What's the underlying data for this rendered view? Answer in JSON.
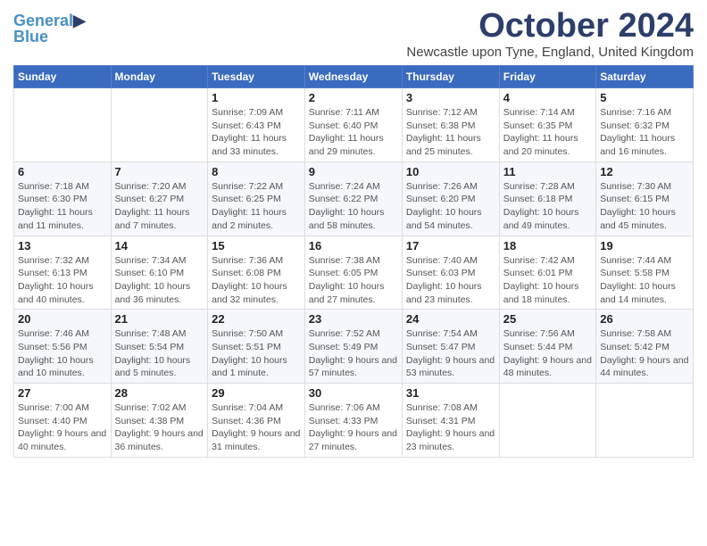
{
  "header": {
    "logo_line1": "General",
    "logo_line2": "Blue",
    "month_title": "October 2024",
    "subtitle": "Newcastle upon Tyne, England, United Kingdom"
  },
  "weekdays": [
    "Sunday",
    "Monday",
    "Tuesday",
    "Wednesday",
    "Thursday",
    "Friday",
    "Saturday"
  ],
  "weeks": [
    [
      {
        "day": "",
        "info": ""
      },
      {
        "day": "",
        "info": ""
      },
      {
        "day": "1",
        "info": "Sunrise: 7:09 AM\nSunset: 6:43 PM\nDaylight: 11 hours and 33 minutes."
      },
      {
        "day": "2",
        "info": "Sunrise: 7:11 AM\nSunset: 6:40 PM\nDaylight: 11 hours and 29 minutes."
      },
      {
        "day": "3",
        "info": "Sunrise: 7:12 AM\nSunset: 6:38 PM\nDaylight: 11 hours and 25 minutes."
      },
      {
        "day": "4",
        "info": "Sunrise: 7:14 AM\nSunset: 6:35 PM\nDaylight: 11 hours and 20 minutes."
      },
      {
        "day": "5",
        "info": "Sunrise: 7:16 AM\nSunset: 6:32 PM\nDaylight: 11 hours and 16 minutes."
      }
    ],
    [
      {
        "day": "6",
        "info": "Sunrise: 7:18 AM\nSunset: 6:30 PM\nDaylight: 11 hours and 11 minutes."
      },
      {
        "day": "7",
        "info": "Sunrise: 7:20 AM\nSunset: 6:27 PM\nDaylight: 11 hours and 7 minutes."
      },
      {
        "day": "8",
        "info": "Sunrise: 7:22 AM\nSunset: 6:25 PM\nDaylight: 11 hours and 2 minutes."
      },
      {
        "day": "9",
        "info": "Sunrise: 7:24 AM\nSunset: 6:22 PM\nDaylight: 10 hours and 58 minutes."
      },
      {
        "day": "10",
        "info": "Sunrise: 7:26 AM\nSunset: 6:20 PM\nDaylight: 10 hours and 54 minutes."
      },
      {
        "day": "11",
        "info": "Sunrise: 7:28 AM\nSunset: 6:18 PM\nDaylight: 10 hours and 49 minutes."
      },
      {
        "day": "12",
        "info": "Sunrise: 7:30 AM\nSunset: 6:15 PM\nDaylight: 10 hours and 45 minutes."
      }
    ],
    [
      {
        "day": "13",
        "info": "Sunrise: 7:32 AM\nSunset: 6:13 PM\nDaylight: 10 hours and 40 minutes."
      },
      {
        "day": "14",
        "info": "Sunrise: 7:34 AM\nSunset: 6:10 PM\nDaylight: 10 hours and 36 minutes."
      },
      {
        "day": "15",
        "info": "Sunrise: 7:36 AM\nSunset: 6:08 PM\nDaylight: 10 hours and 32 minutes."
      },
      {
        "day": "16",
        "info": "Sunrise: 7:38 AM\nSunset: 6:05 PM\nDaylight: 10 hours and 27 minutes."
      },
      {
        "day": "17",
        "info": "Sunrise: 7:40 AM\nSunset: 6:03 PM\nDaylight: 10 hours and 23 minutes."
      },
      {
        "day": "18",
        "info": "Sunrise: 7:42 AM\nSunset: 6:01 PM\nDaylight: 10 hours and 18 minutes."
      },
      {
        "day": "19",
        "info": "Sunrise: 7:44 AM\nSunset: 5:58 PM\nDaylight: 10 hours and 14 minutes."
      }
    ],
    [
      {
        "day": "20",
        "info": "Sunrise: 7:46 AM\nSunset: 5:56 PM\nDaylight: 10 hours and 10 minutes."
      },
      {
        "day": "21",
        "info": "Sunrise: 7:48 AM\nSunset: 5:54 PM\nDaylight: 10 hours and 5 minutes."
      },
      {
        "day": "22",
        "info": "Sunrise: 7:50 AM\nSunset: 5:51 PM\nDaylight: 10 hours and 1 minute."
      },
      {
        "day": "23",
        "info": "Sunrise: 7:52 AM\nSunset: 5:49 PM\nDaylight: 9 hours and 57 minutes."
      },
      {
        "day": "24",
        "info": "Sunrise: 7:54 AM\nSunset: 5:47 PM\nDaylight: 9 hours and 53 minutes."
      },
      {
        "day": "25",
        "info": "Sunrise: 7:56 AM\nSunset: 5:44 PM\nDaylight: 9 hours and 48 minutes."
      },
      {
        "day": "26",
        "info": "Sunrise: 7:58 AM\nSunset: 5:42 PM\nDaylight: 9 hours and 44 minutes."
      }
    ],
    [
      {
        "day": "27",
        "info": "Sunrise: 7:00 AM\nSunset: 4:40 PM\nDaylight: 9 hours and 40 minutes."
      },
      {
        "day": "28",
        "info": "Sunrise: 7:02 AM\nSunset: 4:38 PM\nDaylight: 9 hours and 36 minutes."
      },
      {
        "day": "29",
        "info": "Sunrise: 7:04 AM\nSunset: 4:36 PM\nDaylight: 9 hours and 31 minutes."
      },
      {
        "day": "30",
        "info": "Sunrise: 7:06 AM\nSunset: 4:33 PM\nDaylight: 9 hours and 27 minutes."
      },
      {
        "day": "31",
        "info": "Sunrise: 7:08 AM\nSunset: 4:31 PM\nDaylight: 9 hours and 23 minutes."
      },
      {
        "day": "",
        "info": ""
      },
      {
        "day": "",
        "info": ""
      }
    ]
  ]
}
